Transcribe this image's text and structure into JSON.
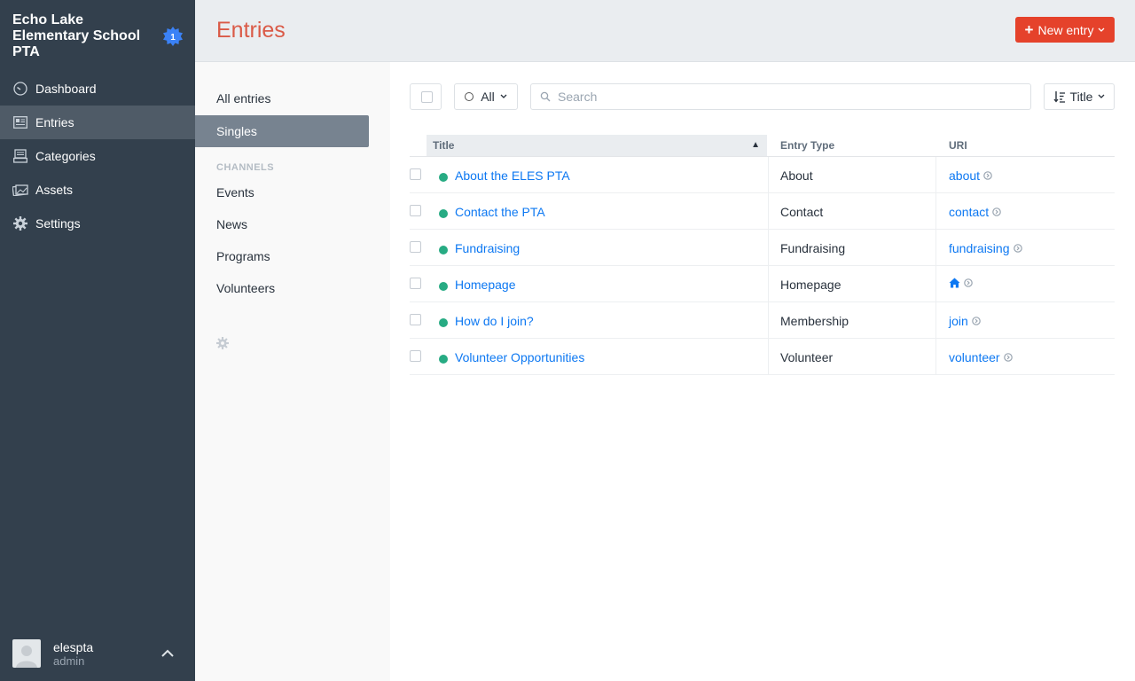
{
  "site": {
    "name": "Echo Lake Elementary School PTA",
    "badge_count": "1"
  },
  "nav": {
    "items": [
      {
        "label": "Dashboard",
        "icon": "dashboard-icon"
      },
      {
        "label": "Entries",
        "icon": "entries-icon",
        "active": true
      },
      {
        "label": "Categories",
        "icon": "categories-icon"
      },
      {
        "label": "Assets",
        "icon": "assets-icon"
      },
      {
        "label": "Settings",
        "icon": "gear-icon"
      }
    ]
  },
  "user": {
    "name": "elespta",
    "role": "admin"
  },
  "header": {
    "title": "Entries",
    "new_entry_label": "New entry"
  },
  "sources": {
    "all_entries": "All entries",
    "singles": "Singles",
    "channels_heading": "CHANNELS",
    "channels": [
      "Events",
      "News",
      "Programs",
      "Volunteers"
    ]
  },
  "toolbar": {
    "status_filter": "All",
    "search_placeholder": "Search",
    "sort_label": "Title"
  },
  "table": {
    "columns": {
      "title": "Title",
      "entry_type": "Entry Type",
      "uri": "URI"
    },
    "rows": [
      {
        "title": "About the ELES PTA",
        "type": "About",
        "uri": "about",
        "status": "live"
      },
      {
        "title": "Contact the PTA",
        "type": "Contact",
        "uri": "contact",
        "status": "live"
      },
      {
        "title": "Fundraising",
        "type": "Fundraising",
        "uri": "fundraising",
        "status": "live"
      },
      {
        "title": "Homepage",
        "type": "Homepage",
        "uri": "",
        "uri_icon": "home-icon",
        "status": "live"
      },
      {
        "title": "How do I join?",
        "type": "Membership",
        "uri": "join",
        "status": "live"
      },
      {
        "title": "Volunteer Opportunities",
        "type": "Volunteer",
        "uri": "volunteer",
        "status": "live"
      }
    ]
  },
  "colors": {
    "sidebar_bg": "#33404d",
    "accent_red": "#e5422b",
    "title_red": "#da5a47",
    "link_blue": "#0d78f2",
    "status_live": "#27ab83",
    "badge_blue": "#3b82f6"
  }
}
